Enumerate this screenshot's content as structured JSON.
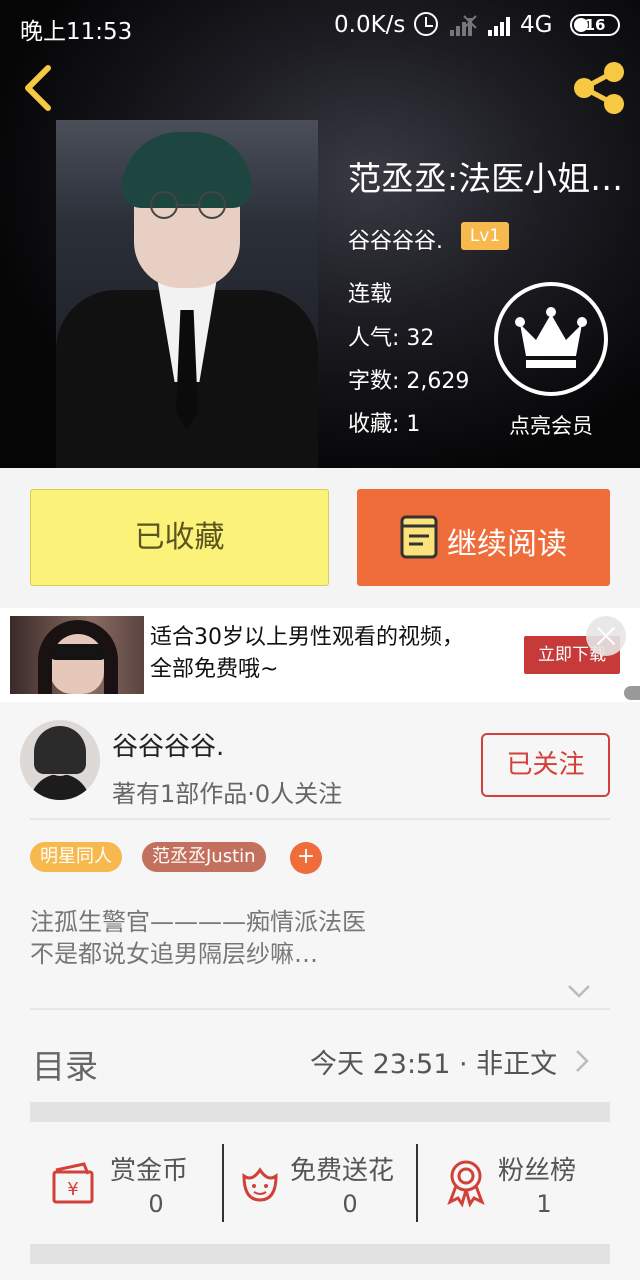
{
  "status_bar": {
    "time": "晚上11:53",
    "network_speed": "0.0K/s",
    "network_type": "4G",
    "battery": "16"
  },
  "book": {
    "title": "范丞丞:法医小姐…",
    "author": "谷谷谷谷.",
    "level": "Lv1",
    "status": "连载",
    "popularity": "人气: 32",
    "word_count": "字数: 2,629",
    "favorites": "收藏: 1",
    "vip_label": "点亮会员"
  },
  "actions": {
    "collected_label": "已收藏",
    "continue_label": "继续阅读"
  },
  "ad": {
    "line1": "适合30岁以上男性观看的视频，",
    "line2": "全部免费哦~",
    "cta": "立即下载"
  },
  "author_section": {
    "name": "谷谷谷谷.",
    "meta": "著有1部作品·0人关注",
    "follow_label": "已关注",
    "tags": [
      "明星同人",
      "范丞丞Justin"
    ],
    "add_tag": "+",
    "summary_line1": "注孤生警官————痴情派法医",
    "summary_line2": "不是都说女追男隔层纱嘛…"
  },
  "catalog": {
    "title": "目录",
    "latest": "今天 23:51 · 非正文"
  },
  "stats": [
    {
      "label": "赏金币",
      "value": "0",
      "icon": "coin-envelope-icon"
    },
    {
      "label": "免费送花",
      "value": "0",
      "icon": "flower-icon"
    },
    {
      "label": "粉丝榜",
      "value": "1",
      "icon": "award-icon"
    }
  ],
  "colors": {
    "accent_orange": "#ee6d3a",
    "collected_yellow": "#fbf27a",
    "follow_red": "#d2403a",
    "tag_yellow": "#f7b84e",
    "tag_brown": "#c4705e"
  }
}
